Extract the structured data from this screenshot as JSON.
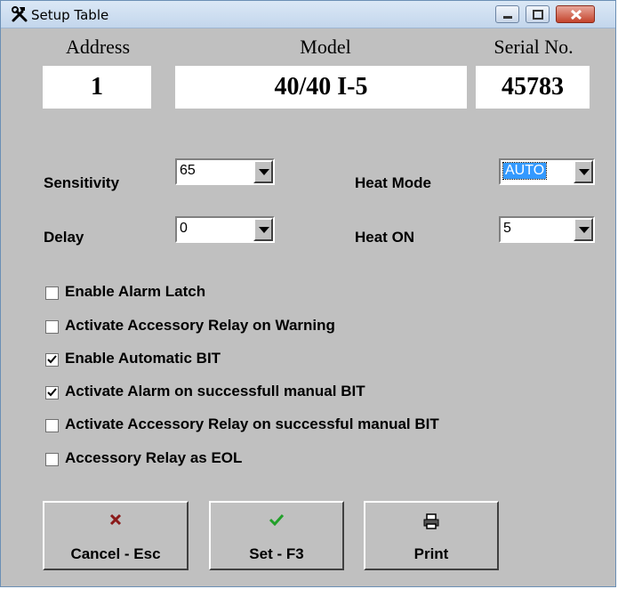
{
  "window": {
    "title": "Setup Table",
    "controls": {
      "minimize_icon": "minimize-icon",
      "maximize_icon": "maximize-icon",
      "close_icon": "close-icon"
    }
  },
  "header": {
    "address": {
      "label": "Address",
      "value": "1"
    },
    "model": {
      "label": "Model",
      "value": "40/40 I-5"
    },
    "serial": {
      "label": "Serial No.",
      "value": "45783"
    }
  },
  "settings": {
    "sensitivity": {
      "label": "Sensitivity",
      "value": "65"
    },
    "heat_mode": {
      "label": "Heat Mode",
      "value": "AUTO"
    },
    "delay": {
      "label": "Delay",
      "value": "0"
    },
    "heat_on": {
      "label": "Heat ON",
      "value": "5"
    }
  },
  "options": [
    {
      "label": "Enable Alarm Latch",
      "checked": false
    },
    {
      "label": "Activate Accessory Relay on Warning",
      "checked": false
    },
    {
      "label": "Enable Automatic BIT",
      "checked": true
    },
    {
      "label": "Activate Alarm on successfull manual BIT",
      "checked": true
    },
    {
      "label": "Activate Accessory Relay on successful manual BIT",
      "checked": false
    },
    {
      "label": "Accessory Relay as EOL",
      "checked": false
    }
  ],
  "buttons": {
    "cancel": {
      "label": "Cancel - Esc",
      "icon": "cross-icon",
      "color": "#8b1a1a"
    },
    "set": {
      "label": "Set - F3",
      "icon": "checkmark-icon",
      "color": "#22a02a"
    },
    "print": {
      "label": "Print",
      "icon": "printer-icon"
    }
  },
  "colors": {
    "window_bg": "#c0c0c0",
    "selection": "#3399ff"
  }
}
